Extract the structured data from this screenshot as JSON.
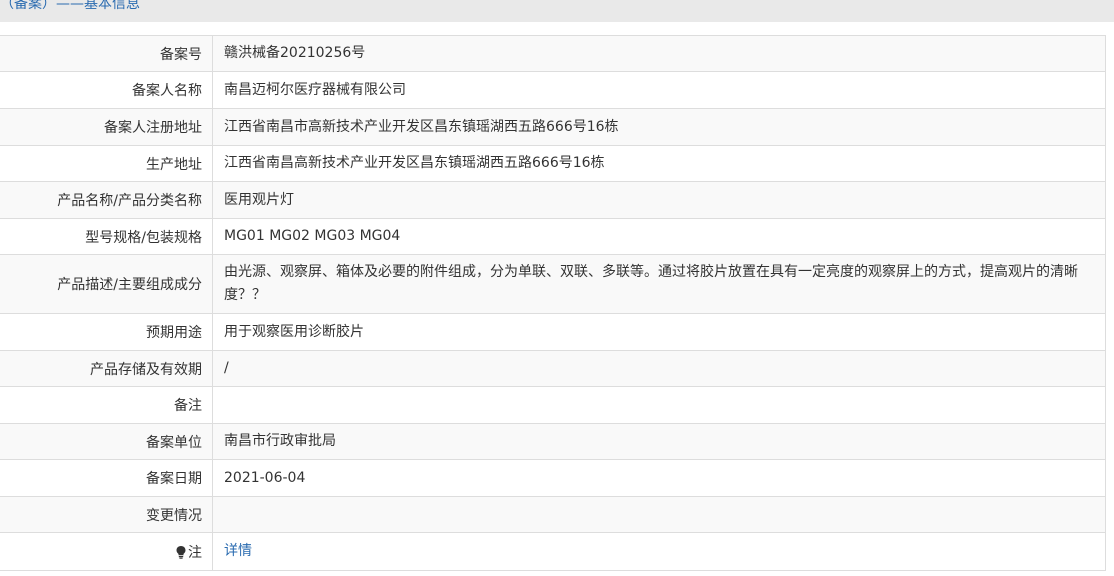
{
  "header": {
    "title": "（备案）——基本信息"
  },
  "fields": [
    {
      "label": "备案号",
      "value": "赣洪械备20210256号"
    },
    {
      "label": "备案人名称",
      "value": "南昌迈柯尔医疗器械有限公司"
    },
    {
      "label": "备案人注册地址",
      "value": "江西省南昌市高新技术产业开发区昌东镇瑶湖西五路666号16栋"
    },
    {
      "label": "生产地址",
      "value": "江西省南昌高新技术产业开发区昌东镇瑶湖西五路666号16栋"
    },
    {
      "label": "产品名称/产品分类名称",
      "value": "医用观片灯"
    },
    {
      "label": "型号规格/包装规格",
      "value": "MG01 MG02 MG03 MG04"
    },
    {
      "label": "产品描述/主要组成成分",
      "value": "由光源、观察屏、箱体及必要的附件组成，分为单联、双联、多联等。通过将胶片放置在具有一定亮度的观察屏上的方式，提高观片的清晰度？？"
    },
    {
      "label": "预期用途",
      "value": "用于观察医用诊断胶片"
    },
    {
      "label": "产品存储及有效期",
      "value": "/"
    },
    {
      "label": "备注",
      "value": ""
    },
    {
      "label": "备案单位",
      "value": "南昌市行政审批局"
    },
    {
      "label": "备案日期",
      "value": "2021-06-04"
    },
    {
      "label": "变更情况",
      "value": ""
    }
  ],
  "note": {
    "icon": "lightbulb-icon",
    "label": "注",
    "link_text": "详情"
  },
  "colors": {
    "accent": "#2a6bb0",
    "border": "#dddddd",
    "stripe": "#f9f9f9",
    "header_bg": "#e9e9e9",
    "text": "#333333"
  }
}
